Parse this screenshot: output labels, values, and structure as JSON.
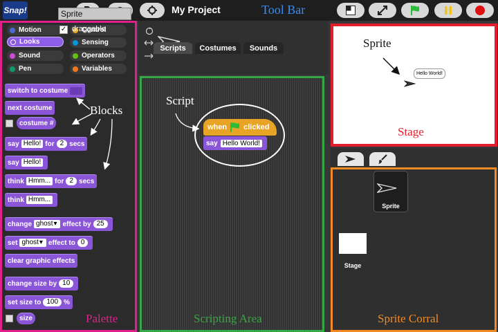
{
  "toolbar": {
    "logo": "Snap!",
    "project_title": "My Project",
    "annotation": "Tool Bar",
    "icons": [
      "file-icon",
      "cloud-icon",
      "gear-icon",
      "stage-size-icon",
      "fullscreen-icon",
      "green-flag-icon",
      "pause-icon",
      "stop-icon"
    ],
    "colors": {
      "flag": "#2bbd3a",
      "pause": "#f2c417",
      "stop": "#e01010"
    }
  },
  "palette": {
    "annotation": "Palette",
    "blocks_annotation": "Blocks",
    "categories": [
      {
        "label": "Motion",
        "color": "#4a6cd4"
      },
      {
        "label": "Control",
        "color": "#e6a822"
      },
      {
        "label": "Looks",
        "color": "#8a55d7"
      },
      {
        "label": "Sensing",
        "color": "#0494dc"
      },
      {
        "label": "Sound",
        "color": "#cf4ad9"
      },
      {
        "label": "Operators",
        "color": "#62c213"
      },
      {
        "label": "Pen",
        "color": "#0e9a6c"
      },
      {
        "label": "Variables",
        "color": "#f3761d"
      }
    ],
    "selected_category": "Looks",
    "blocks": {
      "switch_costume": "switch to costume",
      "next_costume": "next costume",
      "costume_num": "costume #",
      "say_for": {
        "say": "say",
        "text": "Hello!",
        "for": "for",
        "secs_val": "2",
        "secs": "secs"
      },
      "say": {
        "say": "say",
        "text": "Hello!"
      },
      "think_for": {
        "think": "think",
        "text": "Hmm...",
        "for": "for",
        "secs_val": "2",
        "secs": "secs"
      },
      "think": {
        "think": "think",
        "text": "Hmm..."
      },
      "change_effect": {
        "change": "change",
        "effect": "ghost",
        "effect_by": "effect by",
        "value": "25"
      },
      "set_effect": {
        "set": "set",
        "effect": "ghost",
        "effect_to": "effect to",
        "value": "0"
      },
      "clear_effects": "clear graphic effects",
      "change_size": {
        "label": "change size by",
        "value": "10"
      },
      "set_size": {
        "label": "set size to",
        "value": "100",
        "unit": "%"
      },
      "size": "size"
    }
  },
  "sprite_bar": {
    "sprite_name": "Sprite",
    "draggable_label": "draggable",
    "draggable_checked": "✓",
    "tabs": [
      {
        "label": "Scripts",
        "active": true
      },
      {
        "label": "Costumes",
        "active": false
      },
      {
        "label": "Sounds",
        "active": false
      }
    ]
  },
  "scripting_area": {
    "annotation": "Scripting Area",
    "script_annotation": "Script",
    "hat": {
      "when": "when",
      "clicked": "clicked"
    },
    "say_block": {
      "say": "say",
      "text": "Hello World!"
    }
  },
  "stage": {
    "annotation": "Stage",
    "sprite_annotation": "Sprite",
    "speech_bubble": "Hello World!"
  },
  "sprite_corral": {
    "annotation": "Sprite Corral",
    "sprite_label": "Sprite",
    "stage_label": "Stage"
  }
}
